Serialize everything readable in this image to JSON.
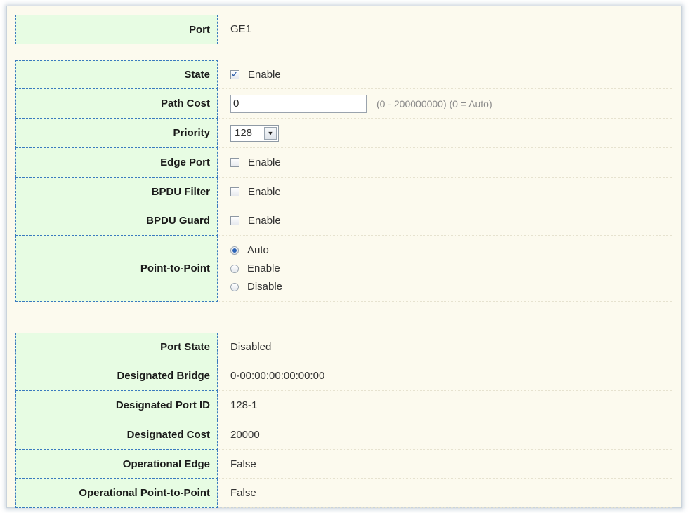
{
  "port": {
    "label": "Port",
    "value": "GE1"
  },
  "settings": {
    "state": {
      "label": "State",
      "checked": true,
      "option": "Enable"
    },
    "path_cost": {
      "label": "Path Cost",
      "value": "0",
      "hint": "(0 - 200000000) (0 = Auto)"
    },
    "priority": {
      "label": "Priority",
      "value": "128"
    },
    "edge_port": {
      "label": "Edge Port",
      "checked": false,
      "option": "Enable"
    },
    "bpdu_filter": {
      "label": "BPDU Filter",
      "checked": false,
      "option": "Enable"
    },
    "bpdu_guard": {
      "label": "BPDU Guard",
      "checked": false,
      "option": "Enable"
    },
    "point_to_point": {
      "label": "Point-to-Point",
      "options": [
        "Auto",
        "Enable",
        "Disable"
      ],
      "selected": "Auto"
    }
  },
  "status": {
    "port_state": {
      "label": "Port State",
      "value": "Disabled"
    },
    "designated_bridge": {
      "label": "Designated Bridge",
      "value": "0-00:00:00:00:00:00"
    },
    "designated_port_id": {
      "label": "Designated Port ID",
      "value": "128-1"
    },
    "designated_cost": {
      "label": "Designated Cost",
      "value": "20000"
    },
    "operational_edge": {
      "label": "Operational Edge",
      "value": "False"
    },
    "operational_p2p": {
      "label": "Operational Point-to-Point",
      "value": "False"
    }
  }
}
